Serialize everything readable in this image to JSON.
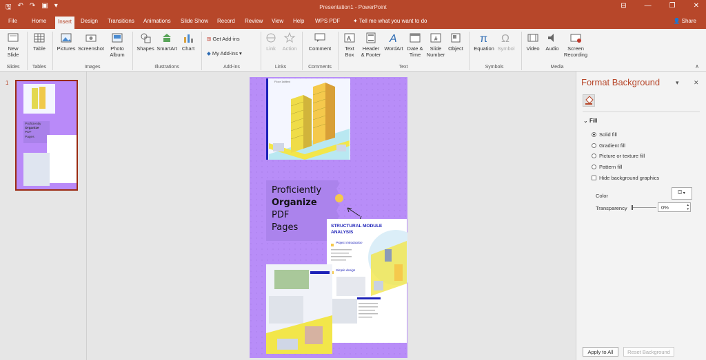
{
  "titlebar": {
    "title": "Presentation1  -  PowerPoint",
    "qat_icons": [
      "save-icon",
      "undo-icon",
      "redo-icon",
      "present-icon",
      "qat-dropdown-icon"
    ],
    "window_icons": [
      "ribbon-display-icon",
      "minimize-icon",
      "restore-icon",
      "close-icon"
    ]
  },
  "tabs": [
    "File",
    "Home",
    "Insert",
    "Design",
    "Transitions",
    "Animations",
    "Slide Show",
    "Record",
    "Review",
    "View",
    "Help",
    "WPS PDF"
  ],
  "active_tab": "Insert",
  "tell_me": "Tell me what you want to do",
  "share": "Share",
  "ribbon": {
    "new_slide": "New\nSlide",
    "table": "Table",
    "pictures": "Pictures",
    "screenshot": "Screenshot",
    "photo_album": "Photo\nAlbum",
    "shapes": "Shapes",
    "smartart": "SmartArt",
    "chart": "Chart",
    "get_addins": "Get Add-ins",
    "my_addins": "My Add-ins",
    "link": "Link",
    "action": "Action",
    "comment": "Comment",
    "text_box": "Text\nBox",
    "header_footer": "Header\n& Footer",
    "wordart": "WordArt",
    "date_time": "Date &\nTime",
    "slide_number": "Slide\nNumber",
    "object": "Object",
    "equation": "Equation",
    "symbol": "Symbol",
    "video": "Video",
    "audio": "Audio",
    "screen_recording": "Screen\nRecording",
    "groups": {
      "slides": "Slides",
      "tables": "Tables",
      "images": "Images",
      "illustrations": "Illustrations",
      "addins": "Add-ins",
      "links": "Links",
      "comments": "Comments",
      "text": "Text",
      "symbols": "Symbols",
      "media": "Media"
    }
  },
  "thumbnail": {
    "slide_number": "1",
    "line1": "Proficiently",
    "line2": "Organize",
    "line3": "PDF",
    "line4": "Pages"
  },
  "slide": {
    "text_line1": "Proficiently",
    "text_line2": "Organize",
    "text_line3": "PDF",
    "text_line4": "Pages",
    "card_title": "STRUCTURAL MODULE\nANALYSIS",
    "card_item1": "Project introduction",
    "card_item2": "Simple design",
    "top_caption": "Floor 1stitled"
  },
  "format_pane": {
    "title": "Format Background",
    "section": "Fill",
    "options": [
      "Solid fill",
      "Gradient fill",
      "Picture or texture fill",
      "Pattern fill"
    ],
    "selected": "Solid fill",
    "hide_bg": "Hide background graphics",
    "color_label": "Color",
    "transparency_label": "Transparency",
    "transparency_value": "0%",
    "apply_all": "Apply to All",
    "reset": "Reset Background"
  },
  "colors": {
    "accent": "#b7472a",
    "slide_bg": "#b88df8"
  }
}
